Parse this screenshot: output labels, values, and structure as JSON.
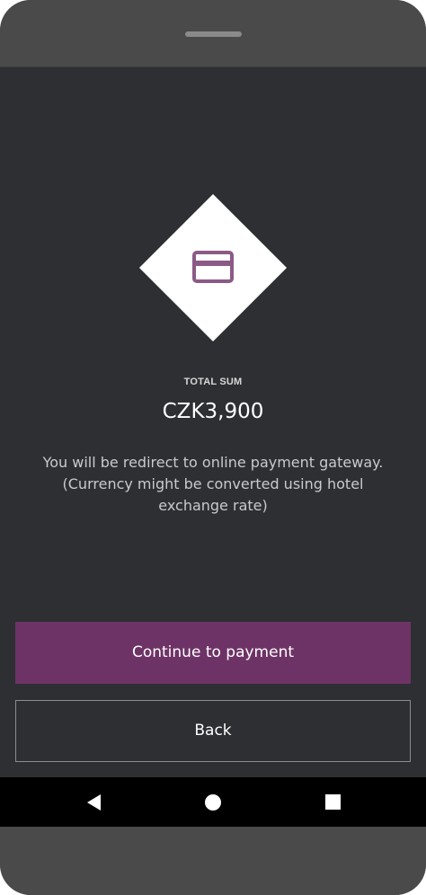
{
  "payment": {
    "label": "TOTAL SUM",
    "amount": "CZK3,900",
    "message_lines": [
      "You will be redirect to online payment gateway.",
      "(Currency might be converted using hotel",
      "exchange rate)"
    ],
    "continue_label": "Continue to payment",
    "back_label": "Back",
    "icon": "credit-card-icon"
  },
  "navbar": {
    "icons": [
      "back-triangle-icon",
      "home-circle-icon",
      "recent-apps-square-icon"
    ]
  },
  "colors": {
    "background": "#2d2f33",
    "primary_button": "#6e3366",
    "icon_accent": "#8c5a86",
    "bezel": "#4a4a4a"
  }
}
